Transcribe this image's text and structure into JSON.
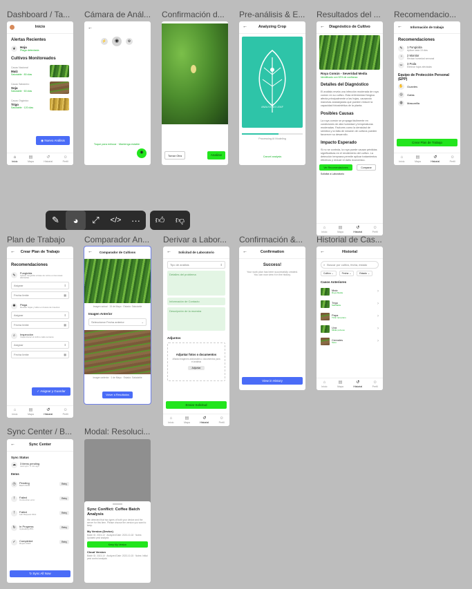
{
  "frames": {
    "dashboard": {
      "title": "Dashboard / Ta...",
      "header": "Inicio",
      "alerts_title": "Alertas Recientes",
      "alert": {
        "name": "Hoja",
        "detail": "Plaga detectada"
      },
      "crops_title": "Cultivos Monitoreados",
      "crops": [
        {
          "label": "Cacao Nacional",
          "name": "Maíz",
          "detail": "Saludable · 80 días"
        },
        {
          "label": "Cacao Sabanero",
          "name": "Soja",
          "detail": "Saludable · 60 días"
        },
        {
          "label": "Cacao Orgánico",
          "name": "Trigo",
          "detail": "Saludable · 120 días"
        }
      ],
      "cta": "Nuevo Análisis"
    },
    "camera": {
      "title": "Cámara de Anál...",
      "hint": "Toque para enfocar · Mantenga estable"
    },
    "confirm_photo": {
      "title": "Confirmación d...",
      "retake": "Tomar Otra",
      "use": "Analizar"
    },
    "pre_analysis": {
      "title": "Pre-análisis & E...",
      "header": "Analyzing Crop",
      "panel_label": "ANALYZING LEAF",
      "progress_text": "Processing AI Modeling",
      "cancel": "Cancel analysis"
    },
    "results": {
      "title": "Resultados del ...",
      "header": "Diagnóstico de Cultivo",
      "diagnosis": "Roya Común - Severidad Media",
      "confidence": "Identificado con 92% de confianza",
      "details_title": "Detalles del Diagnóstico",
      "details_text": "El análisis revela una infección moderada de roya común en su cultivo. Esta enfermedad fúngica afecta principalmente a las hojas, causando manchas anaranjadas que pueden reducir la capacidad fotosintética de la planta.",
      "causes_title": "Posibles Causas",
      "causes_text": "La roya común se propaga fácilmente en condiciones de alta humedad y temperaturas moderadas. Factores como la densidad de siembra y la falta de rotación de cultivos pueden favorecer su desarrollo.",
      "impact_title": "Impacto Esperado",
      "impact_text": "Si no se controla, la roya puede causar pérdidas significativas en el rendimiento del cultivo. La detección temprana permite aplicar tratamientos efectivos y reducir el daño económico.",
      "btn_plan": "Ver Recomendaciones",
      "btn_compare": "Comparar",
      "btn_lab": "Solicitar a Laboratorio"
    },
    "recommendations": {
      "title": "Recomendacio...",
      "header": "Información de trabajo",
      "recs_title": "Recomendaciones",
      "recs": [
        {
          "icon": "spray-icon",
          "name": "1 Fungicida",
          "detail": "Aplicar cada 15 días"
        },
        {
          "icon": "water-icon",
          "name": "2 Monitor",
          "detail": "Revisar humedad semanal"
        },
        {
          "icon": "scissors-icon",
          "name": "3 Poda",
          "detail": "Eliminar hojas afectadas"
        }
      ],
      "epp_title": "Equipo de Protección Personal (EPP)",
      "epp": [
        {
          "icon": "gloves-icon",
          "name": "Guantes"
        },
        {
          "icon": "goggles-icon",
          "name": "Gafas"
        },
        {
          "icon": "mask-icon",
          "name": "Mascarilla"
        }
      ],
      "cta": "Crear Plan de Trabajo"
    },
    "work_plan": {
      "title": "Plan de Trabajo",
      "header": "Crear Plan de Trabajo",
      "recs_title": "Recomendaciones",
      "items": [
        {
          "name": "Fungicida",
          "detail": "Aplicar fungicida a base de cobre en las áreas afectadas",
          "assign": "Asignar",
          "date": "Fecha límite"
        },
        {
          "name": "Plaga",
          "detail": "Revisar hojas y tallos en busca de insectos",
          "assign": "Asignar",
          "date": "Fecha límite"
        },
        {
          "name": "Inspección",
          "detail": "Inspeccionar el cultivo cada semana",
          "assign": "Asignar",
          "date": "Fecha límite"
        }
      ],
      "cta": "Asignar y Guardar"
    },
    "comparator": {
      "title": "Comparador An...",
      "header": "Comparador de Cultivos",
      "current_caption": "Imagen actual · 15 de Mayo · Estado: Saludable",
      "previous_title": "Imagen Anterior",
      "select_placeholder": "Seleccionar Fecha anterior",
      "previous_caption": "Imagen anterior · 1 de Mayo · Estado: Saludable",
      "cta": "Volver a Resultados"
    },
    "lab": {
      "title": "Derivar a Labor...",
      "header": "Solicitud de Laboratorio",
      "type_select": "Tipo de análisis",
      "notes": "Detalles del problema",
      "contact": "Información de Contacto",
      "extra": "Descripción de la muestra",
      "attach_title": "Adjuntos",
      "upload_title": "Adjuntar fotos o documentos",
      "upload_desc": "Añada imágenes adicionales o documentos para el análisis",
      "upload_btn": "Adjuntar",
      "cta": "Enviar Solicitud"
    },
    "confirmation": {
      "title": "Confirmación &...",
      "header": "Confirmation",
      "success": "Success!",
      "message": "Your work plan has been successfully created. You can now view it in the history.",
      "cta": "View in History"
    },
    "history": {
      "title": "Historial de Cas...",
      "header": "Historial",
      "search_placeholder": "Buscar por cultivo, fecha, estado",
      "filters": [
        "Cultivo",
        "Fecha",
        "Estado"
      ],
      "list_title": "Casos Anteriores",
      "cases": [
        {
          "name": "Maíz",
          "status": "Roya Media"
        },
        {
          "name": "Trigo",
          "status": "Saludable"
        },
        {
          "name": "Papa",
          "status": "Tizón temprano"
        },
        {
          "name": "Uva",
          "status": "Mildiú polvoso"
        },
        {
          "name": "Cereales",
          "status": "Sano"
        }
      ]
    },
    "sync": {
      "title": "Sync Center / B...",
      "header": "Sync Center",
      "status_title": "Sync Status",
      "status_main": "3 items pending",
      "status_sub": "Last sync: 5 min ago",
      "queue_title": "Items",
      "items": [
        {
          "icon": "clock-icon",
          "name": "Pending",
          "detail": "Batch #245",
          "action": "Retry"
        },
        {
          "icon": "alert-icon",
          "name": "Failed",
          "detail": "Connection error",
          "action": "Retry"
        },
        {
          "icon": "alert-icon",
          "name": "Failed",
          "detail": "Lab Request #112",
          "action": "Retry"
        },
        {
          "icon": "refresh-icon",
          "name": "In Progress",
          "detail": "Uploading 45%",
          "action": "Retry"
        },
        {
          "icon": "check-icon",
          "name": "Completed",
          "detail": "Report #118",
          "action": "Retry"
        }
      ],
      "cta": "Sync All Now"
    },
    "modal": {
      "title": "Modal: Resoluci...",
      "heading": "Sync Conflict: Coffee Batch Analysis",
      "desc": "We detected that two types of both your device and the server for this item. Please choose the version you want to keep.",
      "my_version_title": "My Version (Device)",
      "my_version_text": "Batch ID: 2023-10 · Analyzed Date: 2023-10-18 · Notes: Updated pest analysis",
      "keep_mine": "Keep My Version",
      "cloud_title": "Cloud Version",
      "cloud_text": "Batch ID: 2023-10 · Analyzed Date: 2023-10-15 · Notes: Initial pest control analysis"
    }
  },
  "tabs": [
    "Inicio",
    "Mapa",
    "Historial",
    "Perfil"
  ],
  "toolbar": {
    "tools": [
      "edit-icon",
      "palette-icon",
      "expand-icon",
      "code-icon",
      "more-icon"
    ],
    "feedback": [
      "thumbs-up-icon",
      "thumbs-down-icon"
    ]
  }
}
